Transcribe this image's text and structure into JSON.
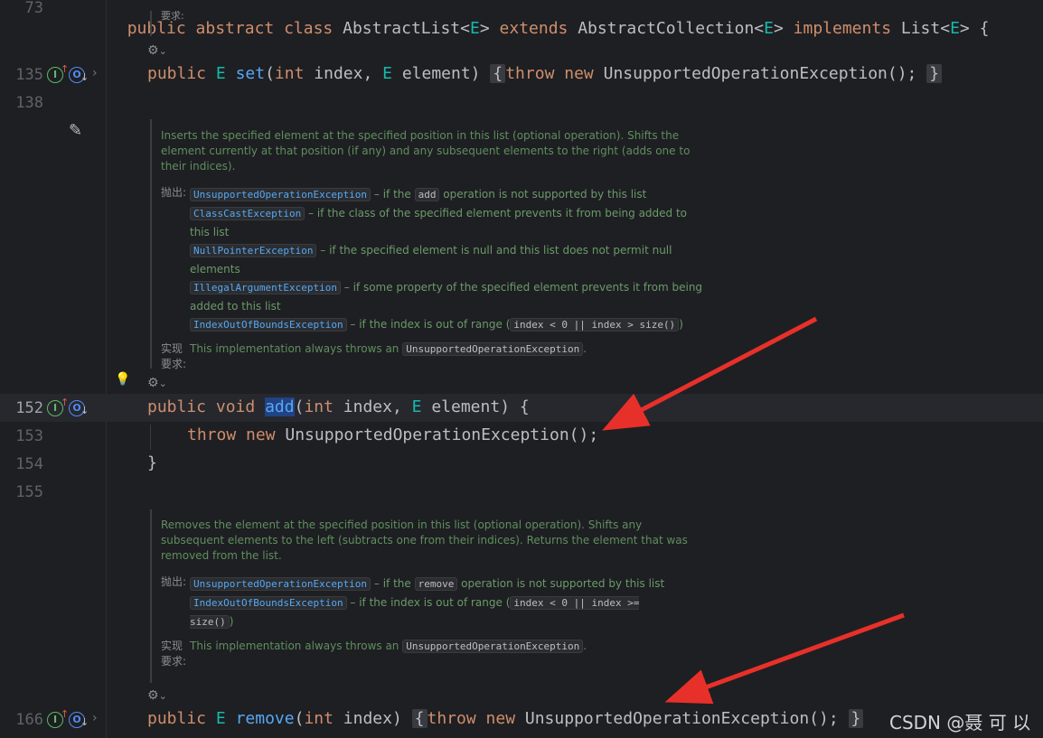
{
  "editor": {
    "top_line": {
      "number": "73",
      "code": "public abstract class AbstractList<E> extends AbstractCollection<E> implements List<E> {"
    },
    "top_partial_label": "要求:",
    "set_line": {
      "number": "135",
      "kw_public": "public",
      "type_E": "E",
      "fn": "set",
      "params_open": "(",
      "kw_int": "int",
      "rest": " index, ",
      "type_E2": "E",
      "rest2": " element)",
      "fold_open": "{",
      "kw_throw": "throw",
      "kw_new": "new",
      "call": " UnsupportedOperationException();",
      "fold_close": "}"
    },
    "blank_line": "138",
    "add_doc": {
      "desc": "Inserts the specified element at the specified position in this list (optional operation). Shifts the element currently at that position (if any) and any subsequent elements to the right (adds one to their indices).",
      "throws_label": "抛出:",
      "throws": [
        {
          "exc": "UnsupportedOperationException",
          "pre": " – if the ",
          "code": "add",
          "post": " operation is not supported by this list"
        },
        {
          "exc": "ClassCastException",
          "pre": " – if the class of the specified element prevents it from being added to this list",
          "code": "",
          "post": ""
        },
        {
          "exc": "NullPointerException",
          "pre": " – if the specified element is null and this list does not permit null elements",
          "code": "",
          "post": ""
        },
        {
          "exc": "IllegalArgumentException",
          "pre": " – if some property of the specified element prevents it from being added to this list",
          "code": "",
          "post": ""
        },
        {
          "exc": "IndexOutOfBoundsException",
          "pre": " – if the index is out of range (",
          "code": "index < 0 || index > size()",
          "post": ")"
        }
      ],
      "impl_label_1": "实现",
      "impl_label_2": "要求:",
      "impl_text": "This implementation always throws an ",
      "impl_code": "UnsupportedOperationException",
      "impl_end": "."
    },
    "add_lines": [
      {
        "number": "152",
        "kw_public": "public",
        "kw_void": "void",
        "fn": "add",
        "open": "(",
        "kw_int": "int",
        "rest": " index, ",
        "type_E": "E",
        "rest2": " element) {"
      },
      {
        "number": "153",
        "kw_throw": "throw",
        "kw_new": "new",
        "rest": " UnsupportedOperationException();"
      },
      {
        "number": "154",
        "code": "}"
      },
      {
        "number": "155",
        "code": ""
      }
    ],
    "remove_doc": {
      "desc": "Removes the element at the specified position in this list (optional operation). Shifts any subsequent elements to the left (subtracts one from their indices). Returns the element that was removed from the list.",
      "throws_label": "抛出:",
      "throws": [
        {
          "exc": "UnsupportedOperationException",
          "pre": " – if the ",
          "code": "remove",
          "post": " operation is not supported by this list"
        },
        {
          "exc": "IndexOutOfBoundsException",
          "pre": " – if the index is out of range (",
          "code": "index < 0 || index >= size()",
          "post": ")"
        }
      ],
      "impl_label_1": "实现",
      "impl_label_2": "要求:",
      "impl_text": "This implementation always throws an ",
      "impl_code": "UnsupportedOperationException",
      "impl_end": "."
    },
    "remove_line": {
      "number": "166",
      "kw_public": "public",
      "type_E": "E",
      "fn": "remove",
      "open": "(",
      "kw_int": "int",
      "rest": " index)",
      "fold_open": "{",
      "kw_throw": "throw",
      "kw_new": "new",
      "call": " UnsupportedOperationException();",
      "fold_close": "}"
    }
  },
  "gutter_icons": {
    "implements": "I",
    "overrides": "O",
    "chevron": "›",
    "ai_icon": "⚙",
    "ai_chevron": "⌄"
  },
  "colors": {
    "annotation_arrow": "#e8302a"
  },
  "watermark": "CSDN @聂 可 以"
}
